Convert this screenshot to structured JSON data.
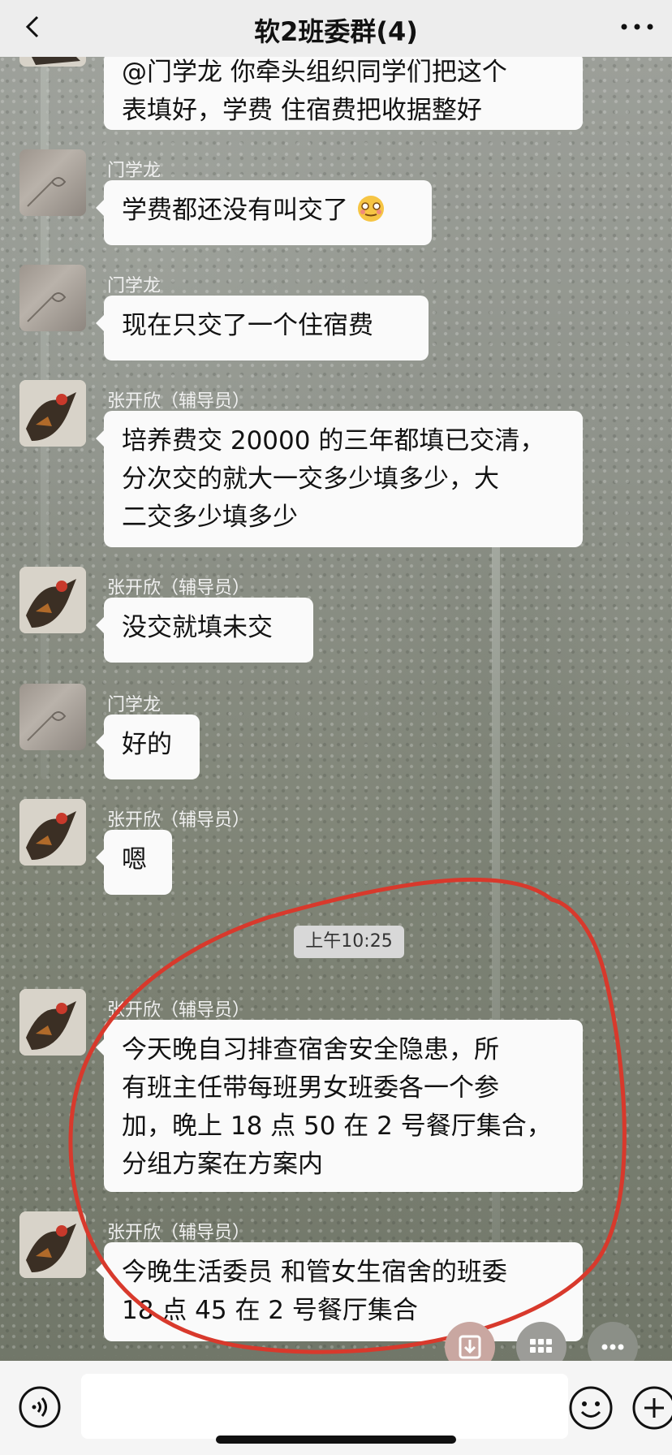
{
  "header": {
    "back_icon": "chevron-left-icon",
    "title": "软2班委群(4)",
    "more_icon": "more-horizontal-icon"
  },
  "messages": [
    {
      "sender": "",
      "lines": [
        "@门学龙 你牵头组织同学们把这个",
        "表填好，学费 住宿费把收据整好"
      ],
      "avatar": "bird"
    },
    {
      "sender": "门学龙",
      "lines": [
        "学费都还没有叫交了"
      ],
      "emoji": "embarrassed-emoji",
      "avatar": "sand"
    },
    {
      "sender": "门学龙",
      "lines": [
        "现在只交了一个住宿费"
      ],
      "avatar": "sand"
    },
    {
      "sender": "张开欣（辅导员）",
      "lines": [
        "培养费交 20000 的三年都填已交清，",
        "分次交的就大一交多少填多少，大",
        "二交多少填多少"
      ],
      "avatar": "bird"
    },
    {
      "sender": "张开欣（辅导员）",
      "lines": [
        "没交就填未交"
      ],
      "avatar": "bird"
    },
    {
      "sender": "门学龙",
      "lines": [
        "好的"
      ],
      "avatar": "sand"
    },
    {
      "sender": "张开欣（辅导员）",
      "lines": [
        "嗯"
      ],
      "avatar": "bird"
    },
    {
      "sender": "张开欣（辅导员）",
      "lines": [
        "今天晚自习排查宿舍安全隐患，所",
        "有班主任带每班男女班委各一个参",
        "加，晚上 18 点 50 在 2 号餐厅集合，",
        "分组方案在方案内"
      ],
      "avatar": "bird"
    },
    {
      "sender": "张开欣（辅导员）",
      "lines": [
        "今晚生活委员 和管女生宿舍的班委",
        "18 点 45 在 2 号餐厅集合"
      ],
      "avatar": "bird"
    }
  ],
  "timestamp": "上午10:25",
  "annotation": {
    "color": "#d8392c",
    "shape": "hand-drawn-circle"
  },
  "floating_buttons": [
    {
      "icon": "download-icon",
      "color": "#c9a7a1"
    },
    {
      "icon": "grid-apps-icon",
      "color": "#9c9c98"
    },
    {
      "icon": "more-dots-icon",
      "color": "#8b8f87"
    }
  ],
  "input_bar": {
    "voice_icon": "voice-icon",
    "emoji_icon": "emoji-icon",
    "plus_icon": "plus-icon"
  }
}
